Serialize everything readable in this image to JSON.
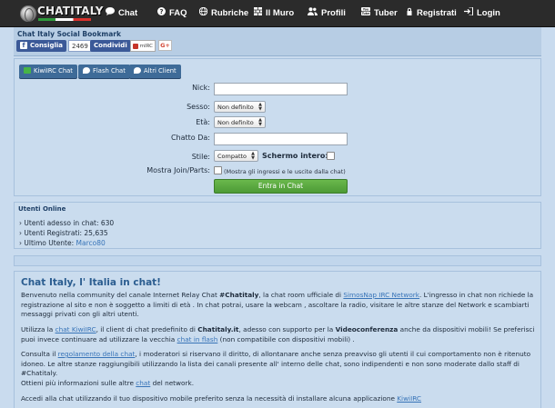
{
  "nav": {
    "logo": "CHATITALY",
    "items": [
      {
        "label": "Chat",
        "icon": "chat-bubble-icon"
      },
      {
        "label": "FAQ",
        "icon": "question-icon"
      },
      {
        "label": "Rubriche",
        "icon": "globe-icon"
      },
      {
        "label": "Il Muro",
        "icon": "wall-icon"
      },
      {
        "label": "Profili",
        "icon": "users-icon"
      },
      {
        "label": "Tuber",
        "icon": "youtube-icon"
      },
      {
        "label": "Registrati",
        "icon": "register-icon"
      },
      {
        "label": "Login",
        "icon": "login-icon"
      }
    ]
  },
  "bookmark": {
    "title": "Chat Italy Social Bookmark",
    "fb_like": "Consiglia",
    "fb_count": "2469",
    "fb_share": "Condividi",
    "mirc": "mIRC",
    "gplus": "G+"
  },
  "chat_form": {
    "tabs": [
      "KiwiIRC Chat",
      "Flash Chat",
      "Altri Client"
    ],
    "nick_label": "Nick:",
    "sesso_label": "Sesso:",
    "sesso_value": "Non definito",
    "eta_label": "Età:",
    "eta_value": "Non definito",
    "chatto_label": "Chatto Da:",
    "stile_label": "Stile:",
    "stile_value": "Compatto",
    "schermo_label": "Schermo intero:",
    "mostra_label": "Mostra Join/Parts:",
    "mostra_note": "(Mostra gli ingressi e le uscite dalla chat)",
    "enter_button": "Entra in Chat"
  },
  "users": {
    "title": "Utenti Online",
    "adesso": "› Utenti adesso in chat: 630",
    "registrati": "› Utenti Registrati: 25,635",
    "ultimo_prefix": "› Ultimo Utente: ",
    "ultimo_name": "Marco80"
  },
  "info": {
    "title": "Chat Italy, l' Italia in chat!",
    "p1_a": "Benvenuto nella community del canale Internet Relay Chat ",
    "p1_b": "#Chatitaly",
    "p1_c": ", la chat room ufficiale di ",
    "p1_link": "SimosNap IRC Network",
    "p1_d": ". L'ingresso in chat non richiede la registrazione al sito e non è soggetto a limiti di età . In chat potrai, usare la webcam , ascoltare la radio, visitare le altre stanze del Network e scambiarti messaggi privati con gli altri utenti.",
    "p2_a": "Utilizza la ",
    "p2_link1": "chat KiwiIRC",
    "p2_b": ", il client di chat predefinito di ",
    "p2_c": "Chatitaly.it",
    "p2_d": ", adesso con supporto per la ",
    "p2_e": "Videoconferenza",
    "p2_f": " anche da dispositivi mobili! Se preferisci puoi invece continuare ad utilizzare la vecchia ",
    "p2_link2": "chat in flash",
    "p2_g": " (non compatibile con dispositivi mobili) .",
    "p3_a": "Consulta il ",
    "p3_link1": "regolamento della chat",
    "p3_b": ", i moderatori si riservano il diritto, di allontanare anche senza preavviso gli utenti il cui comportamento non è ritenuto idoneo. Le altre stanze raggiungibili utilizzando la lista dei canali presente all' interno delle chat, sono indipendenti e non sono moderate dallo staff di #Chatitaly.",
    "p3_c": "Ottieni più informazioni sulle altre ",
    "p3_link2": "chat",
    "p3_d": " del network.",
    "p4_a": "Accedi alla chat utilizzando il tuo dispositivo mobile preferito senza la necessità di installare alcuna applicazione ",
    "p4_link": "KiwiIRC"
  }
}
